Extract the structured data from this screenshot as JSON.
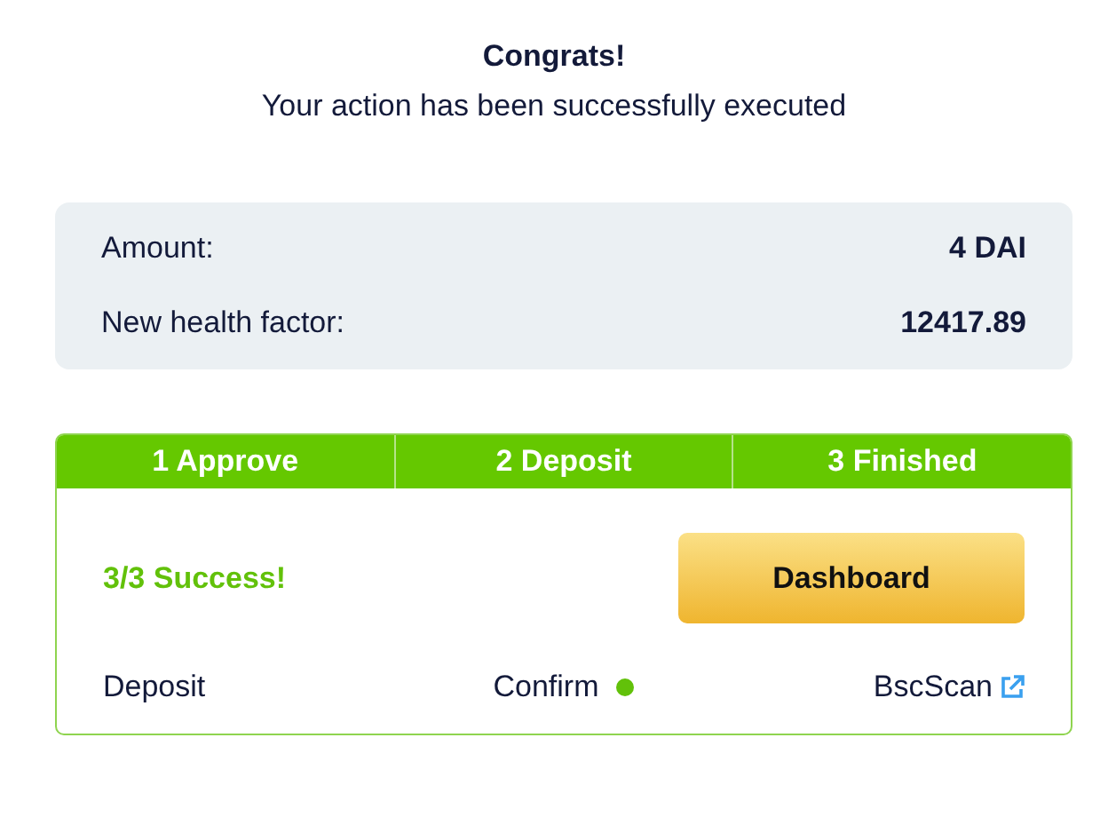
{
  "header": {
    "title": "Congrats!",
    "subtitle": "Your action has been successfully executed"
  },
  "details": [
    {
      "label": "Amount:",
      "value": "4 DAI"
    },
    {
      "label": "New health factor:",
      "value": "12417.89"
    }
  ],
  "steps": [
    {
      "label": "1 Approve"
    },
    {
      "label": "2 Deposit"
    },
    {
      "label": "3 Finished"
    }
  ],
  "status": "3/3 Success!",
  "dashboard_button": "Dashboard",
  "footer": {
    "action": "Deposit",
    "state": "Confirm",
    "link": "BscScan"
  }
}
